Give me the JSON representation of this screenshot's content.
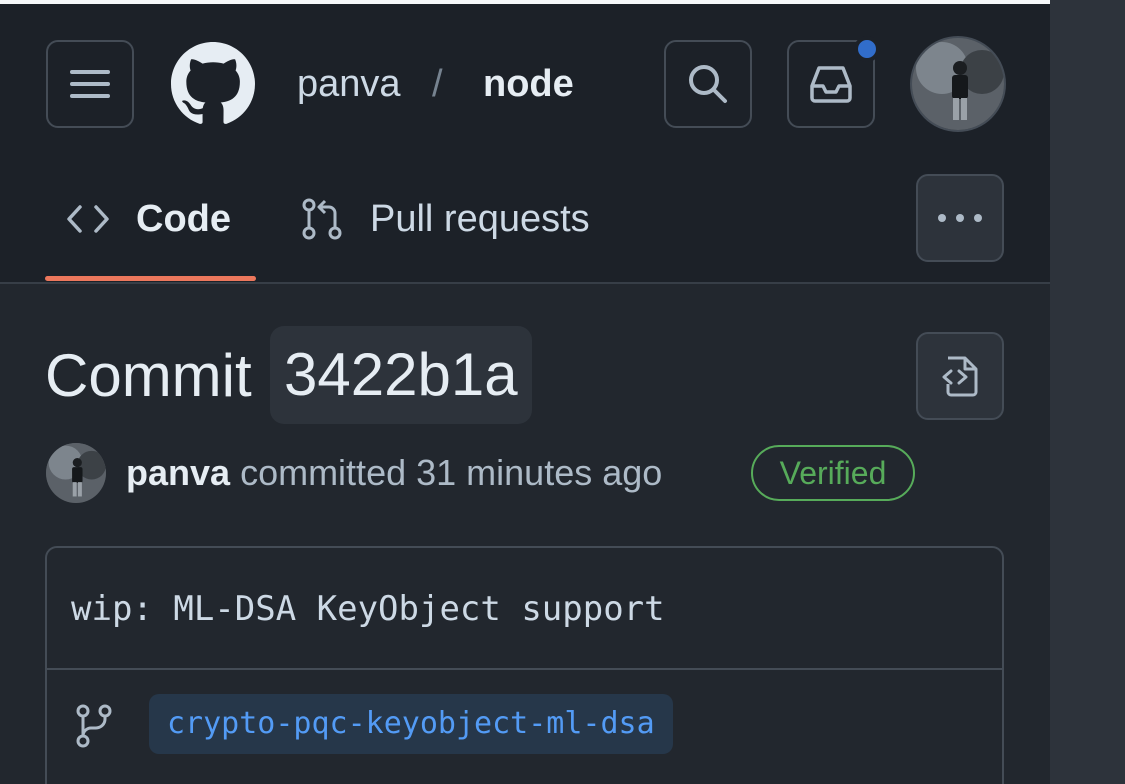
{
  "header": {
    "owner": "panva",
    "separator": "/",
    "repo": "node",
    "has_unread_notifications": true,
    "accent_color": "#316dca"
  },
  "tabs": [
    {
      "label": "Code",
      "icon": "code-icon",
      "selected": true
    },
    {
      "label": "Pull requests",
      "icon": "git-pull-request-icon",
      "selected": false
    }
  ],
  "commit": {
    "title_prefix": "Commit",
    "sha": "3422b1a",
    "author": "panva",
    "action": "committed",
    "time": "31 minutes ago",
    "badge": "Verified",
    "message": "wip: ML-DSA KeyObject support",
    "branch": "crypto-pqc-keyobject-ml-dsa"
  },
  "colors": {
    "underline": "#ec775c",
    "verified": "#57ab5a",
    "link": "#539bf5"
  }
}
